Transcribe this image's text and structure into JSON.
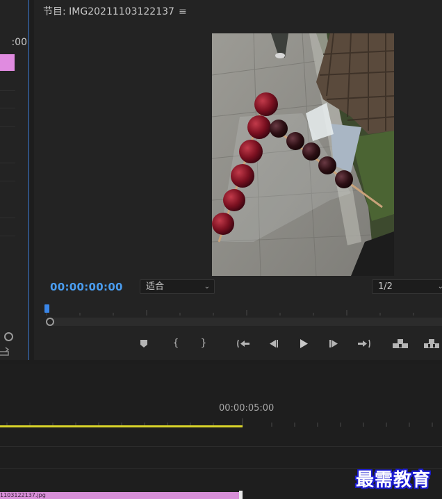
{
  "source_panel": {
    "timecode_fragment": ":00",
    "clip_color": "#e08be0"
  },
  "program_monitor": {
    "title": "节目: IMG20211103122137",
    "menu_icon": "hamburger-menu-icon",
    "current_timecode": "00:00:00:00",
    "zoom_fit": "适合",
    "resolution": "1/2",
    "timecode_color": "#4a9df0",
    "transport_controls": [
      {
        "name": "add-marker-button",
        "icon": "marker-icon"
      },
      {
        "name": "mark-in-button",
        "icon": "mark-in-icon"
      },
      {
        "name": "mark-out-button",
        "icon": "mark-out-icon"
      },
      {
        "name": "go-to-in-button",
        "icon": "go-to-in-icon"
      },
      {
        "name": "step-back-button",
        "icon": "step-back-icon"
      },
      {
        "name": "play-button",
        "icon": "play-icon"
      },
      {
        "name": "step-forward-button",
        "icon": "step-forward-icon"
      },
      {
        "name": "go-to-out-button",
        "icon": "go-to-out-icon"
      },
      {
        "name": "lift-button",
        "icon": "lift-icon"
      },
      {
        "name": "extract-button",
        "icon": "extract-icon"
      }
    ]
  },
  "timeline": {
    "ruler_timecode": "00:00:05:00",
    "work_area_color": "#d9d52a",
    "clip_name": "1103122137.jpg",
    "clip_color": "#d88fd8"
  },
  "watermark": {
    "text": "最需教育"
  }
}
